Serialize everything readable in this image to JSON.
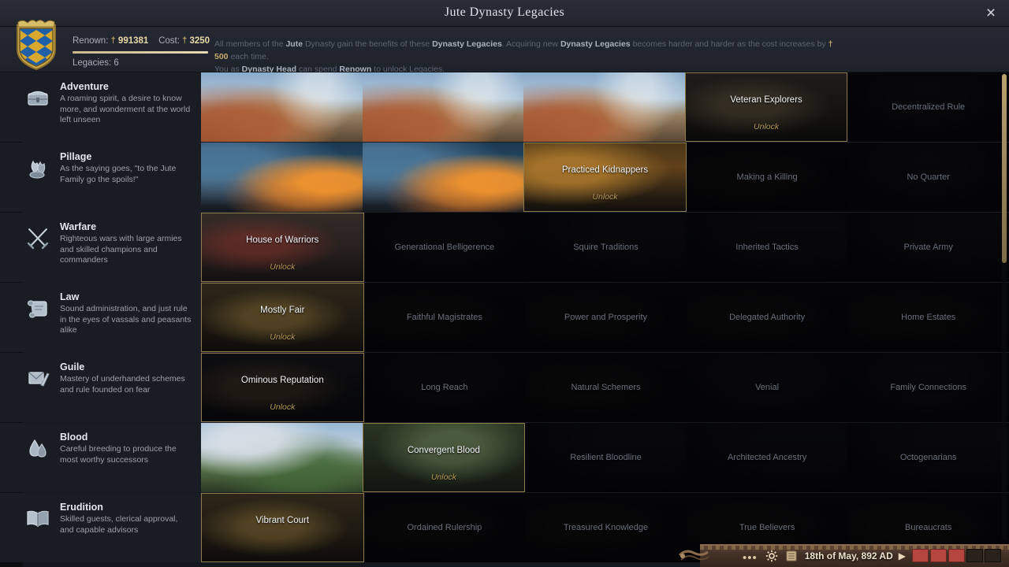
{
  "window": {
    "title": "Jute Dynasty Legacies",
    "close_label": "×"
  },
  "header": {
    "coat_of_arms_name": "jute-dynasty-coat-of-arms",
    "renown_label": "Renown:",
    "renown_value": "991381",
    "cost_label": "Cost:",
    "cost_value": "3250",
    "renown_icon": "†",
    "legacies_label": "Legacies: 6",
    "description_line1_a": "All members of the ",
    "description_dynasty": "Jute",
    "description_line1_b": " Dynasty gain the benefits of these ",
    "description_legacies1": "Dynasty Legacies",
    "description_line1_c": ". Acquiring new ",
    "description_legacies2": "Dynasty Legacies",
    "description_line1_d": " becomes harder and harder as the cost increases by ",
    "description_cost_inc": "† 500",
    "description_line1_e": " each time.",
    "description_line2_a": "You as ",
    "description_head": "Dynasty Head",
    "description_line2_b": " can spend ",
    "description_renown": "Renown",
    "description_line2_c": " to unlock Legacies."
  },
  "tracks": [
    {
      "name": "Adventure",
      "icon": "chest-icon",
      "description": "A roaming spirit, a desire to know more, and wonderment at the world left unseen",
      "cells": [
        {
          "label": "",
          "state": "owned",
          "art": "art-harbour",
          "unlock": ""
        },
        {
          "label": "",
          "state": "owned",
          "art": "art-harbour",
          "unlock": ""
        },
        {
          "label": "",
          "state": "owned",
          "art": "art-harbour",
          "unlock": ""
        },
        {
          "label": "Veteran Explorers",
          "state": "available",
          "art": "art-throne",
          "unlock": "Unlock"
        },
        {
          "label": "Decentralized Rule",
          "state": "locked",
          "art": "art-dark",
          "unlock": ""
        }
      ]
    },
    {
      "name": "Pillage",
      "icon": "torch-icon",
      "description": "As the saying goes, \"to the Jute Family go the spoils!\"",
      "cells": [
        {
          "label": "",
          "state": "owned",
          "art": "art-raid",
          "unlock": ""
        },
        {
          "label": "",
          "state": "owned",
          "art": "art-raid",
          "unlock": ""
        },
        {
          "label": "Practiced Kidnappers",
          "state": "available",
          "art": "art-raid-end",
          "unlock": "Unlock"
        },
        {
          "label": "Making a Killing",
          "state": "locked",
          "art": "art-shadow",
          "unlock": ""
        },
        {
          "label": "No Quarter",
          "state": "locked",
          "art": "art-dark",
          "unlock": ""
        }
      ]
    },
    {
      "name": "Warfare",
      "icon": "crossed-swords-icon",
      "description": "Righteous wars with large armies and skilled champions and commanders",
      "cells": [
        {
          "label": "House of Warriors",
          "state": "available",
          "art": "art-hall",
          "unlock": "Unlock"
        },
        {
          "label": "Generational Belligerence",
          "state": "locked",
          "art": "art-dark",
          "unlock": ""
        },
        {
          "label": "Squire Traditions",
          "state": "locked",
          "art": "art-field",
          "unlock": ""
        },
        {
          "label": "Inherited Tactics",
          "state": "locked",
          "art": "art-field",
          "unlock": ""
        },
        {
          "label": "Private Army",
          "state": "locked",
          "art": "art-field",
          "unlock": ""
        }
      ]
    },
    {
      "name": "Law",
      "icon": "scroll-icon",
      "description": "Sound administration, and just rule in the eyes of vassals and peasants alike",
      "cells": [
        {
          "label": "Mostly Fair",
          "state": "available",
          "art": "art-court",
          "unlock": "Unlock"
        },
        {
          "label": "Faithful Magistrates",
          "state": "locked",
          "art": "art-shadow",
          "unlock": ""
        },
        {
          "label": "Power and Prosperity",
          "state": "locked",
          "art": "art-shadow",
          "unlock": ""
        },
        {
          "label": "Delegated Authority",
          "state": "locked",
          "art": "art-shadow",
          "unlock": ""
        },
        {
          "label": "Home Estates",
          "state": "locked",
          "art": "art-shadow",
          "unlock": ""
        }
      ]
    },
    {
      "name": "Guile",
      "icon": "dagger-letter-icon",
      "description": "Mastery of underhanded schemes and rule founded on fear",
      "cells": [
        {
          "label": "Ominous Reputation",
          "state": "available",
          "art": "art-shadow",
          "unlock": "Unlock"
        },
        {
          "label": "Long Reach",
          "state": "locked",
          "art": "art-dark",
          "unlock": ""
        },
        {
          "label": "Natural Schemers",
          "state": "locked",
          "art": "art-shadow",
          "unlock": ""
        },
        {
          "label": "Venial",
          "state": "locked",
          "art": "art-dark",
          "unlock": ""
        },
        {
          "label": "Family Connections",
          "state": "locked",
          "art": "art-dark",
          "unlock": ""
        }
      ]
    },
    {
      "name": "Blood",
      "icon": "blood-drops-icon",
      "description": "Careful breeding to produce the most worthy successors",
      "cells": [
        {
          "label": "",
          "state": "owned",
          "art": "art-castle",
          "unlock": ""
        },
        {
          "label": "Convergent Blood",
          "state": "available",
          "art": "art-garden",
          "unlock": "Unlock"
        },
        {
          "label": "Resilient Bloodline",
          "state": "locked",
          "art": "art-field",
          "unlock": ""
        },
        {
          "label": "Architected Ancestry",
          "state": "locked",
          "art": "art-field",
          "unlock": ""
        },
        {
          "label": "Octogenarians",
          "state": "locked",
          "art": "art-field",
          "unlock": ""
        }
      ]
    },
    {
      "name": "Erudition",
      "icon": "open-book-icon",
      "description": "Skilled guests, clerical approval, and capable advisors",
      "cells": [
        {
          "label": "Vibrant Court",
          "state": "available",
          "art": "art-court",
          "unlock": ""
        },
        {
          "label": "Ordained Rulership",
          "state": "locked",
          "art": "art-shadow",
          "unlock": ""
        },
        {
          "label": "Treasured Knowledge",
          "state": "locked",
          "art": "art-shadow",
          "unlock": ""
        },
        {
          "label": "True Believers",
          "state": "locked",
          "art": "art-shadow",
          "unlock": ""
        },
        {
          "label": "Bureaucrats",
          "state": "locked",
          "art": "art-shadow",
          "unlock": ""
        }
      ]
    }
  ],
  "gamebar": {
    "menu_dots": "•••",
    "gear_icon": "gear-icon",
    "ledger_icon": "ledger-icon",
    "date": "18th of May, 892 AD",
    "play_icon": "▶",
    "speed_blocks": [
      true,
      true,
      true,
      false,
      false
    ]
  },
  "colors": {
    "gold": "#b79b57",
    "accent_border": "#8d7b4c",
    "speed_active": "#b5453f"
  }
}
